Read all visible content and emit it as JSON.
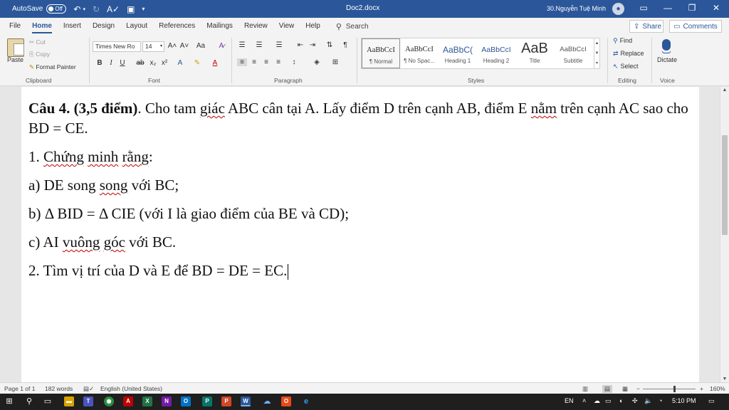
{
  "titlebar": {
    "autosave_label": "AutoSave",
    "autosave_state": "Off",
    "doc_title": "Doc2.docx",
    "user": "30.Nguyễn Tuệ Minh"
  },
  "tabs": [
    "File",
    "Home",
    "Insert",
    "Design",
    "Layout",
    "References",
    "Mailings",
    "Review",
    "View",
    "Help"
  ],
  "active_tab": "Home",
  "search_label": "Search",
  "share_label": "Share",
  "comments_label": "Comments",
  "clipboard": {
    "paste": "Paste",
    "cut": "Cut",
    "copy": "Copy",
    "format_painter": "Format Painter",
    "label": "Clipboard"
  },
  "font": {
    "name": "Times New Ro",
    "size": "14",
    "label": "Font"
  },
  "paragraph_label": "Paragraph",
  "styles": {
    "label": "Styles",
    "items": [
      {
        "sample": "AaBbCcI",
        "name": "¶ Normal"
      },
      {
        "sample": "AaBbCcI",
        "name": "¶ No Spac..."
      },
      {
        "sample": "AaBbC(",
        "name": "Heading 1"
      },
      {
        "sample": "AaBbCcI",
        "name": "Heading 2"
      },
      {
        "sample": "AaB",
        "name": "Title"
      },
      {
        "sample": "AaBbCcI",
        "name": "Subtitle"
      }
    ]
  },
  "editing": {
    "label": "Editing",
    "find": "Find",
    "replace": "Replace",
    "select": "Select"
  },
  "voice": {
    "label": "Voice",
    "dictate": "Dictate"
  },
  "document": {
    "q_title": "Câu 4. (3,5 điểm)",
    "q_line1_rest": ". Cho tam ",
    "q_giac": "giác",
    "q_line1_mid": " ABC cân tại A. Lấy điểm D trên cạnh AB, điểm E ",
    "q_nam": "nằm",
    "q_line1_end": " trên cạnh AC sao cho BD = CE.",
    "l1_prefix": "1. ",
    "l1_w1": "Chứng",
    "l1_sp": " ",
    "l1_w2": "minh",
    "l1_sp2": " ",
    "l1_w3": "rằng",
    "l1_end": ":",
    "la_prefix": "a) DE song ",
    "la_song": "song",
    "la_end": " với BC;",
    "lb": "b) Δ BID = Δ CIE (với I là giao điểm của BE và CD);",
    "lc_prefix": "c) AI ",
    "lc_vuong": "vuông",
    "lc_sp": " ",
    "lc_goc": "góc",
    "lc_end": " với BC.",
    "l2": "2. Tìm vị trí của D và E để BD = DE = EC."
  },
  "statusbar": {
    "page": "Page 1 of 1",
    "words": "182 words",
    "language": "English (United States)",
    "zoom": "160%"
  },
  "taskbar": {
    "lang": "EN",
    "time": "5:10 PM"
  },
  "colors": {
    "accent": "#2b579a",
    "taskbar": "#1f1f1f",
    "spellcheck": "#c00000"
  }
}
